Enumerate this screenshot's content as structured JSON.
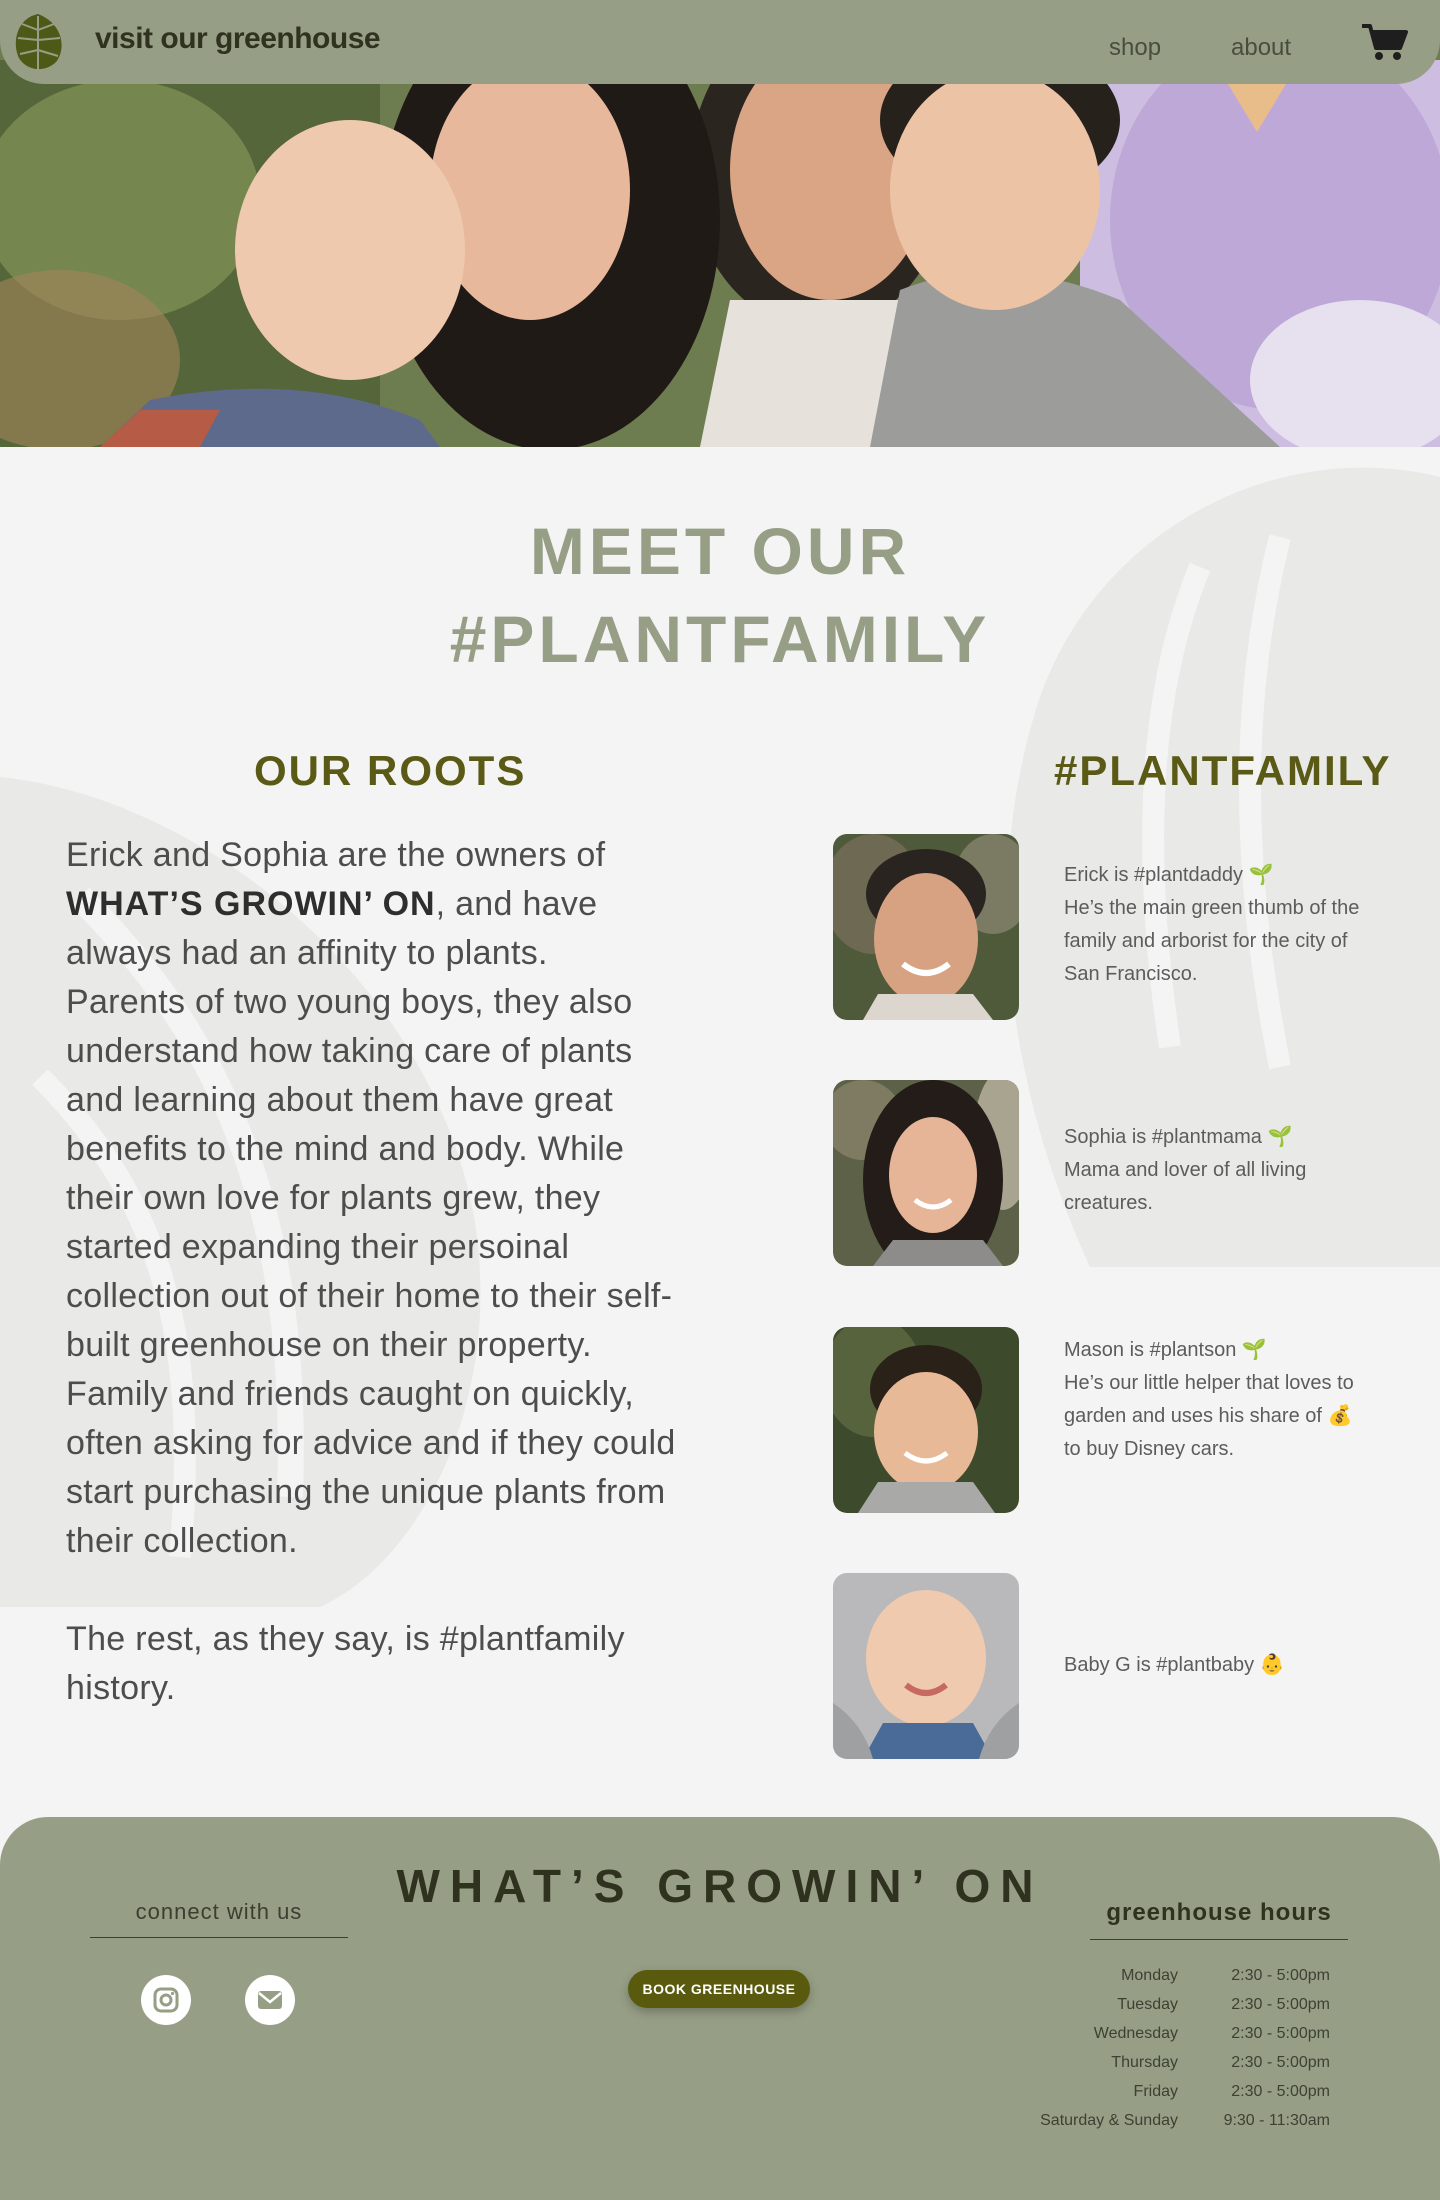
{
  "header": {
    "brand": "visit our greenhouse",
    "nav": {
      "shop": "shop",
      "about": "about"
    },
    "logo_icon": "monstera-leaf-icon",
    "cart_icon": "shopping-cart-icon"
  },
  "hero": {
    "image": "family-photo"
  },
  "main": {
    "title_line1": "MEET OUR",
    "title_line2": "#PLANTFAMILY",
    "roots": {
      "heading": "OUR ROOTS",
      "p1_before": "Erick and Sophia are the owners of ",
      "p1_bold": "WHAT’S GROWIN’ ON",
      "p1_after": ", and have always had an affinity to plants.",
      "p2": "Parents of two young boys, they also understand how taking care of plants and learning about them have great benefits to the mind and body. While their own love for plants grew, they started expanding their persoinal collection out of their home to their self-built greenhouse on their property. Family and friends caught on quickly, often asking for advice and if they could start purchasing the unique plants from their collection.",
      "p3": "The rest, as they say, is #plantfamily history."
    },
    "family": {
      "heading": "#PLANTFAMILY",
      "members": [
        {
          "title": "Erick is #plantdaddy",
          "emoji": "🌱",
          "desc": "He’s the main green thumb of the family and arborist for the city of San Francisco."
        },
        {
          "title": "Sophia is #plantmama",
          "emoji": "🌱",
          "desc": "Mama and lover of all living creatures."
        },
        {
          "title": "Mason is #plantson",
          "emoji": "🌱",
          "desc_before": "He’s our little helper that loves to garden and uses his share of ",
          "desc_emoji": "💰",
          "desc_after": " to buy Disney cars."
        },
        {
          "title": "Baby G is #plantbaby",
          "emoji": "👶"
        }
      ]
    }
  },
  "footer": {
    "connect": "connect with us",
    "title": "WHAT’S GROWIN’ ON",
    "book_button": "BOOK GREENHOUSE",
    "hours_heading": "greenhouse hours",
    "hours": [
      {
        "day": "Monday",
        "time": "2:30 - 5:00pm"
      },
      {
        "day": "Tuesday",
        "time": "2:30 - 5:00pm"
      },
      {
        "day": "Wednesday",
        "time": "2:30 - 5:00pm"
      },
      {
        "day": "Thursday",
        "time": "2:30 - 5:00pm"
      },
      {
        "day": "Friday",
        "time": "2:30 - 5:00pm"
      },
      {
        "day": "Saturday & Sunday",
        "time": "9:30 - 11:30am"
      }
    ],
    "social_icons": [
      "instagram-icon",
      "email-icon"
    ]
  },
  "colors": {
    "sage": "#969f86",
    "olive": "#5a5a16",
    "accent": "#e9bd8a",
    "background": "#f4f4f4"
  }
}
